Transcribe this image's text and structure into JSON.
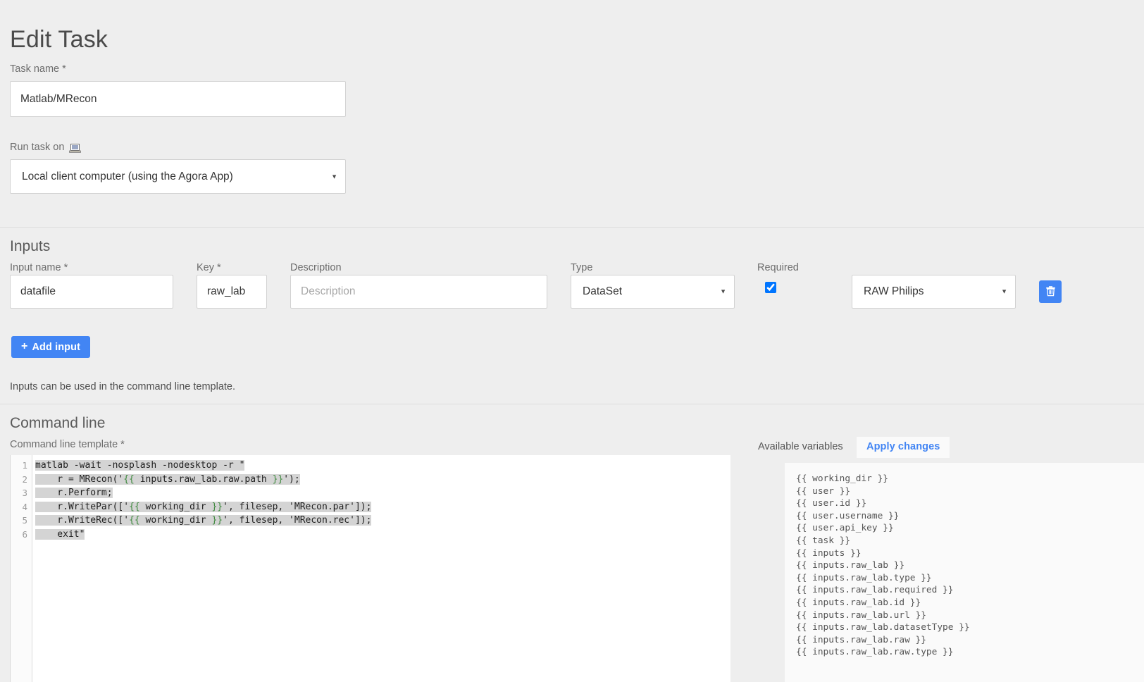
{
  "page": {
    "title": "Edit Task"
  },
  "task": {
    "name_label": "Task name *",
    "name_value": "Matlab/MRecon",
    "run_on_label": "Run task on",
    "run_on_icon": "laptop-icon",
    "run_on_value": "Local client computer (using the Agora App)"
  },
  "inputs": {
    "section_title": "Inputs",
    "columns": {
      "input_name": "Input name *",
      "key": "Key *",
      "description": "Description",
      "type": "Type",
      "required": "Required"
    },
    "rows": [
      {
        "input_name": "datafile",
        "key": "raw_lab",
        "description_value": "",
        "description_placeholder": "Description",
        "type": "DataSet",
        "required": true,
        "dataset_type": "RAW Philips",
        "delete_icon": "trash-icon"
      }
    ],
    "add_button_label": "Add input",
    "add_button_icon": "plus-icon",
    "hint": "Inputs can be used in the command line template."
  },
  "command_line": {
    "section_title": "Command line",
    "template_label": "Command line template *",
    "line_numbers": [
      "1",
      "2",
      "3",
      "4",
      "5",
      "6"
    ],
    "code_lines": [
      "matlab -wait -nosplash -nodesktop -r \"",
      "    r = MRecon('{{ inputs.raw_lab.raw.path }}');",
      "    r.Perform;",
      "    r.WritePar(['{{ working_dir }}', filesep, 'MRecon.par']);",
      "    r.WriteRec(['{{ working_dir }}', filesep, 'MRecon.rec']);",
      "    exit\""
    ]
  },
  "variables": {
    "label": "Available variables",
    "apply_changes_label": "Apply changes",
    "items": [
      "{{ working_dir }}",
      "{{ user }}",
      "{{ user.id }}",
      "{{ user.username }}",
      "{{ user.api_key }}",
      "{{ task }}",
      "{{ inputs }}",
      "{{ inputs.raw_lab }}",
      "{{ inputs.raw_lab.type }}",
      "{{ inputs.raw_lab.required }}",
      "{{ inputs.raw_lab.id }}",
      "{{ inputs.raw_lab.url }}",
      "{{ inputs.raw_lab.datasetType }}",
      "{{ inputs.raw_lab.raw }}",
      "{{ inputs.raw_lab.raw.type }}"
    ]
  },
  "colors": {
    "accent": "#4285f4",
    "page_background": "#eeeeee",
    "template_token": "#3f8a3f"
  }
}
